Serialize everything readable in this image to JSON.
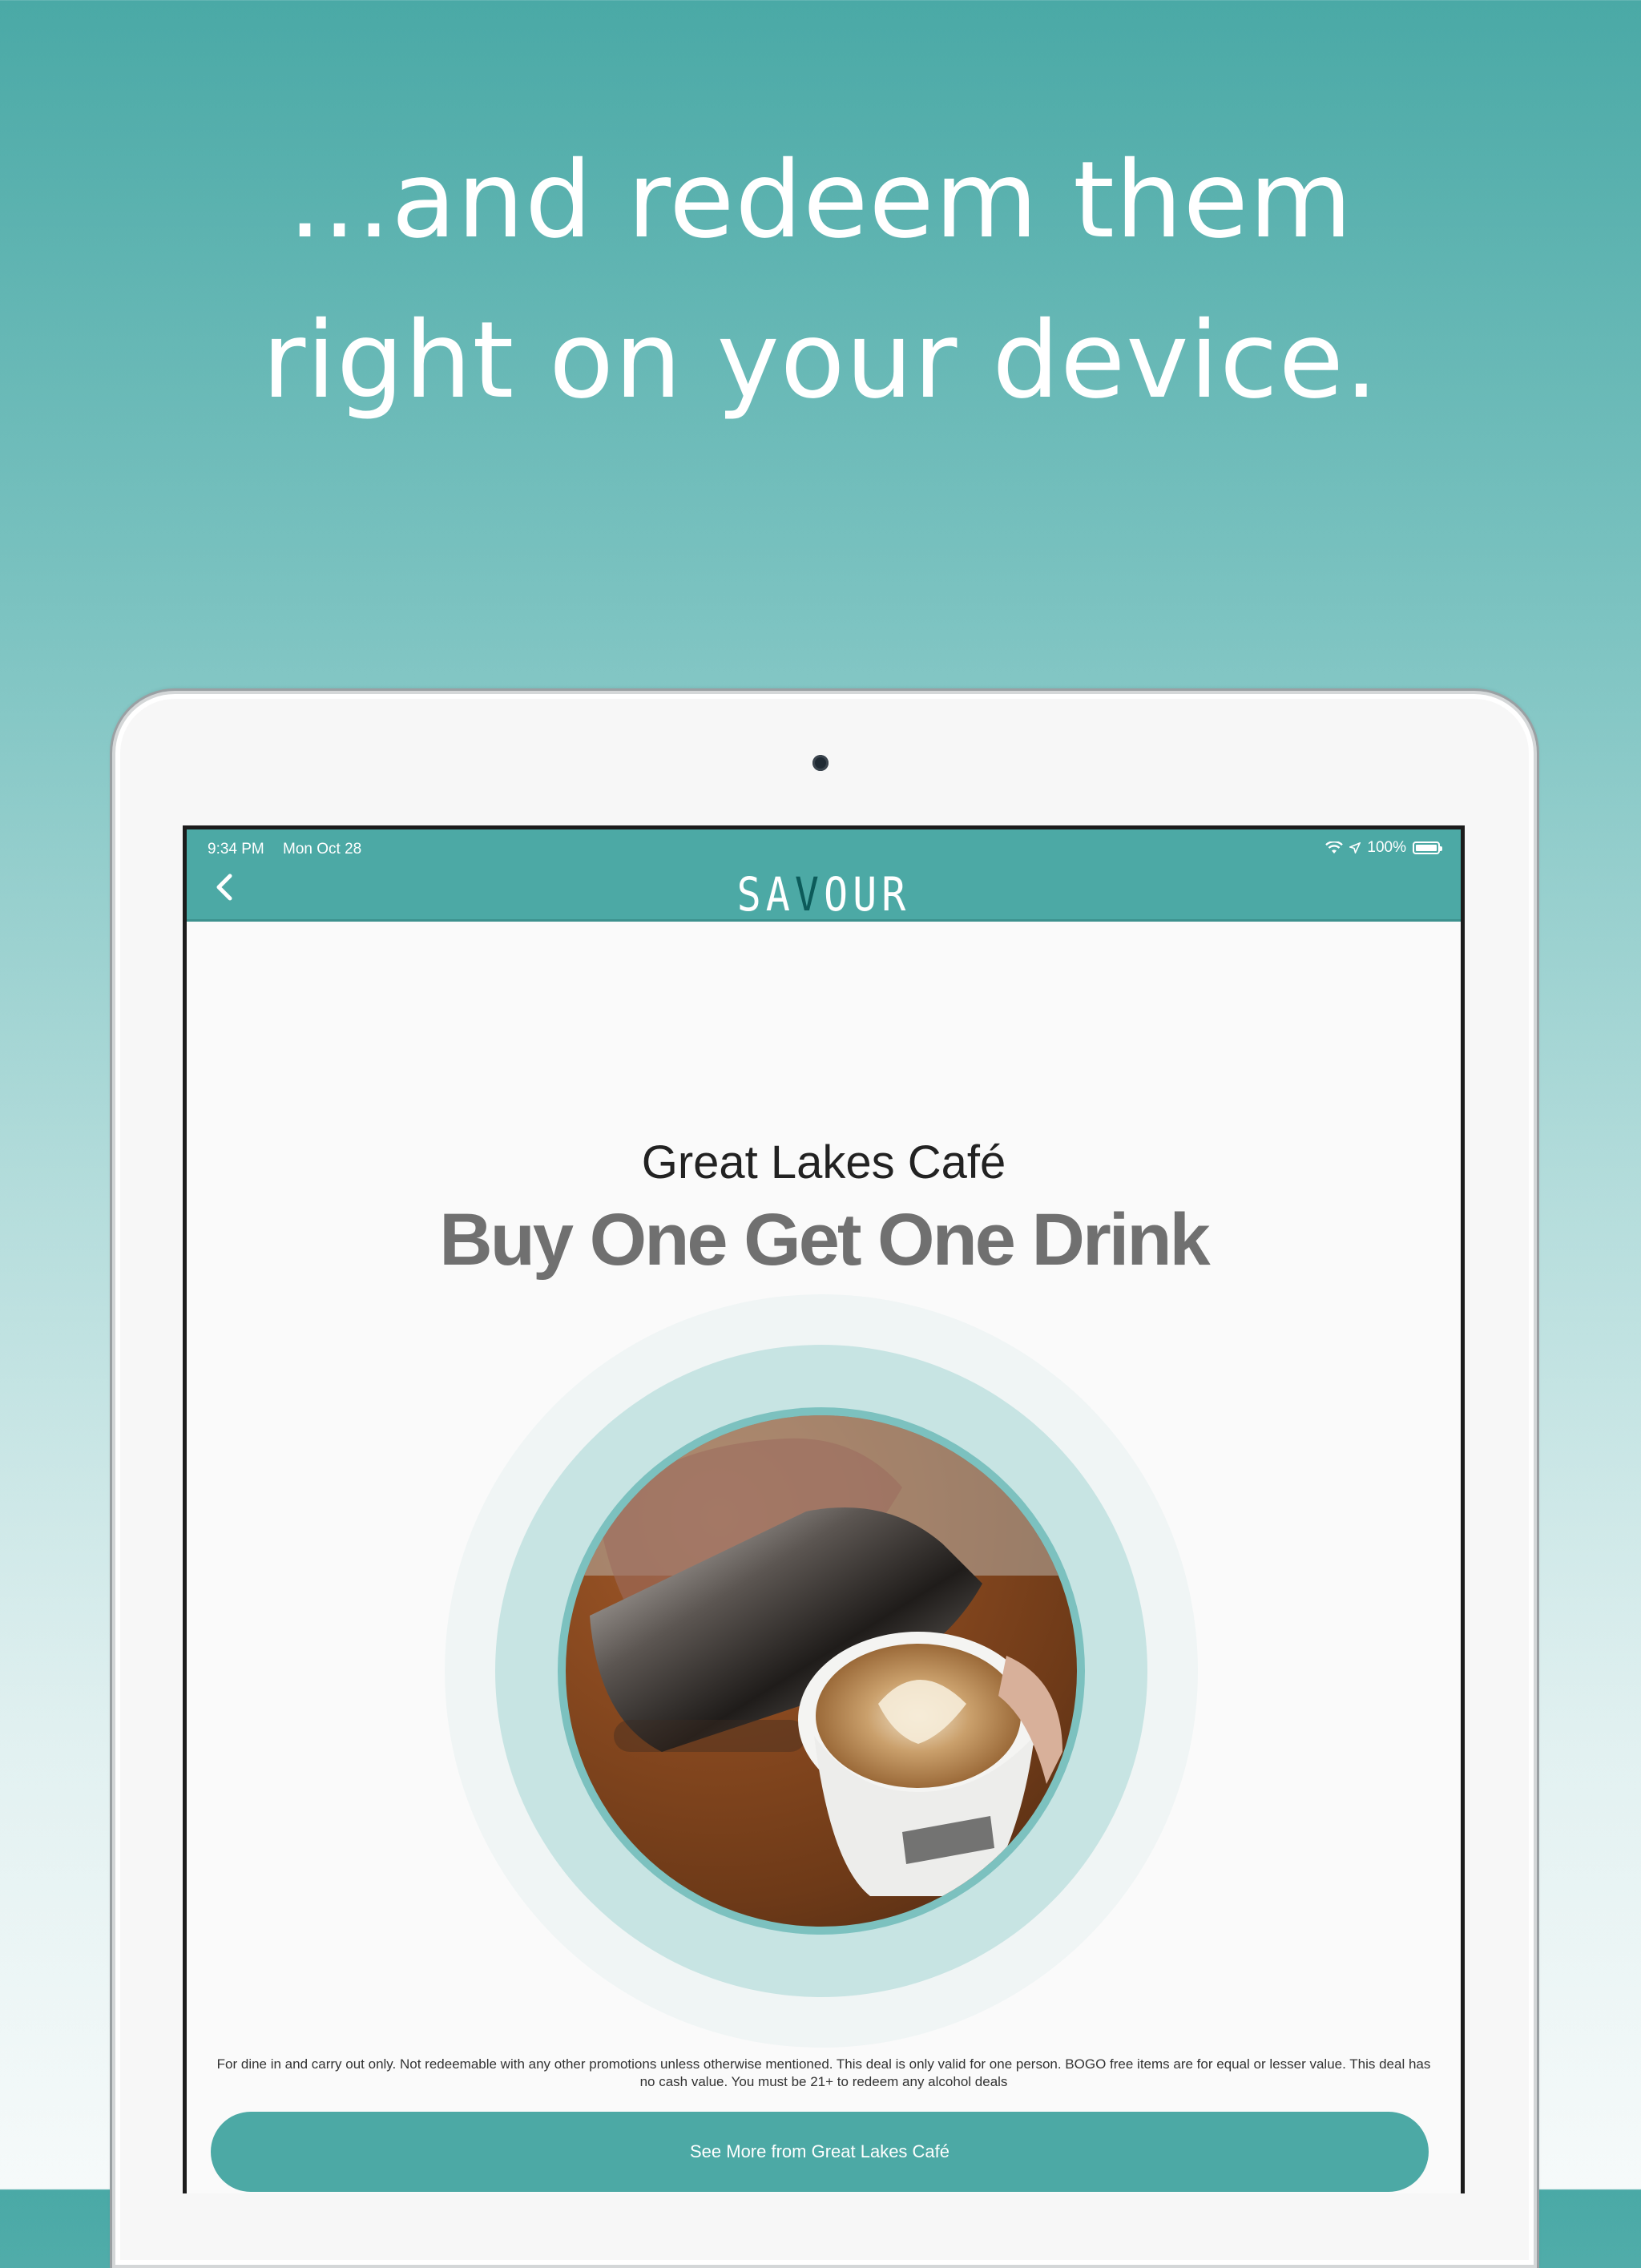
{
  "headline": {
    "line1": "...and redeem them",
    "line2": "right on your device."
  },
  "status_bar": {
    "time": "9:34 PM",
    "date": "Mon Oct 28",
    "battery": "100%"
  },
  "app": {
    "logo_left": "SA",
    "logo_v": "V",
    "logo_right": "OUR",
    "accent_color": "#4ca9a5"
  },
  "deal": {
    "venue": "Great Lakes Café",
    "title": "Buy One Get One Drink",
    "image_icon": "coffee-latte-art-photo",
    "disclaimer": "For dine in and carry out only. Not redeemable with any other promotions unless otherwise mentioned. This deal is only valid for one person. BOGO free items are for equal or lesser value. This deal has no cash value. You must be 21+ to redeem any alcohol deals",
    "cta_label": "See More from Great Lakes Café"
  }
}
